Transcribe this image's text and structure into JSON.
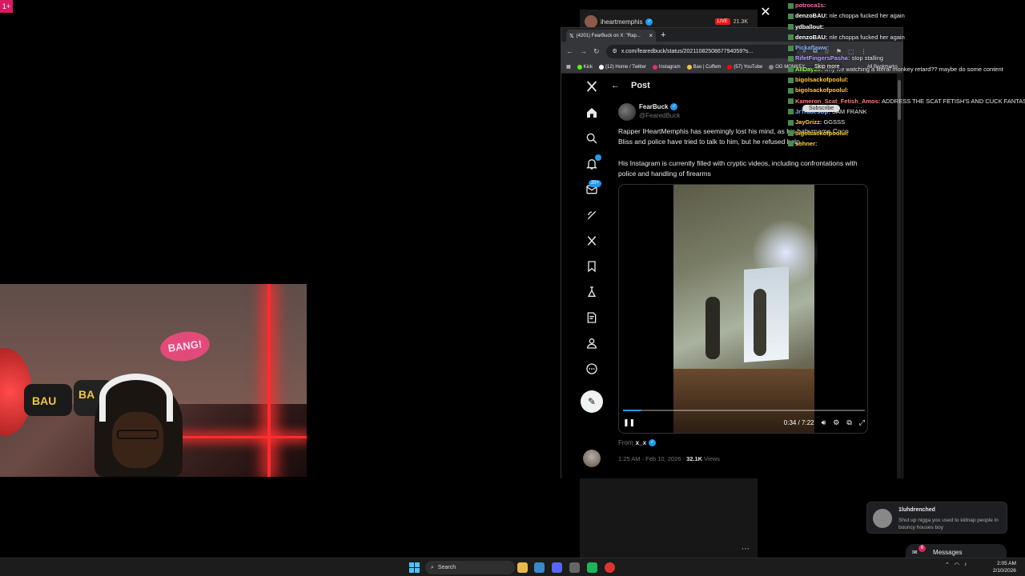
{
  "colors": {
    "accent": "#1d9bf0",
    "live": "#e91916",
    "corner_badge": "#d81b60",
    "taskbar": "#1c1c1c"
  },
  "corner_badge": {
    "icon": "plus-badge-icon",
    "label": "1+"
  },
  "behind_stream": {
    "channel": "iheartmemphis",
    "live": "LIVE",
    "viewers": "21.3K",
    "more": "⋯"
  },
  "browser": {
    "tab_title": "(4201) FearBuck on X: \"Rap...",
    "url": "x.com/fearedbuck/status/2021108250867794059?s...",
    "bookmarks": [
      {
        "label": "Kick",
        "color": "#53fc18"
      },
      {
        "label": "(12) Home / Twitter",
        "color": "#ffffff"
      },
      {
        "label": "Instagram",
        "color": "#e1306c"
      },
      {
        "label": "Bao | Cuffem",
        "color": "#f2c53d"
      },
      {
        "label": "(57) YouTube",
        "color": "#ff0000"
      },
      {
        "label": "OG MONKEY",
        "color": "#888888"
      }
    ],
    "all_bookmarks": "All Bookmarks"
  },
  "x": {
    "header_title": "Post",
    "nav_badges": {
      "notifications": "",
      "messages": "20+"
    },
    "post": {
      "author_name": "FearBuck",
      "author_handle": "@FearedBuck",
      "text1": "Rapper IHeartMemphis has seemingly lost his mind, as his babymama Coco Bliss and police have tried to talk to him, but he refused help.",
      "text2": "His Instagram is currently filled with cryptic videos, including confrontations with police and handling of firearms",
      "video": {
        "current": "0:34",
        "duration": "7:22",
        "separator": " / ",
        "progress": 0.077
      },
      "from_label": "From",
      "from_user": "x_x",
      "timestamp": "1:25 AM · Feb 10, 2026 · ",
      "views": "32.1K",
      "views_label": " Views"
    }
  },
  "chat": [
    {
      "user": "potroca1s:",
      "text": "",
      "color": "#ff6bb5"
    },
    {
      "user": "denzoBAU:",
      "text": "nle choppa fucked her again",
      "color": "#ffffff"
    },
    {
      "user": "ydballout:",
      "text": "",
      "color": "#ffffff"
    },
    {
      "user": "denzoBAU:",
      "text": "nle choppa fucked her again",
      "color": "#ffffff"
    },
    {
      "user": "Pickaflaww:",
      "text": "",
      "color": "#8ab4ff"
    },
    {
      "user": "RifetFingersPasha:",
      "text": "stop stalling",
      "color": "#b5a0ff"
    },
    {
      "user": "AllDay28:",
      "text": "why we watching a literal monkey retard?? maybe do some content",
      "color": "#9cff57"
    },
    {
      "user": "bigolsackofpoolul:",
      "text": "",
      "color": "#ffcc33"
    },
    {
      "user": "bigolsackofpoolul:",
      "text": "",
      "color": "#ffcc33"
    },
    {
      "user": "Kameron_Scat_Fetish_Amos:",
      "text": "ADDRESS THE SCAT FETISH'S AND CUCK FANTASIES @sierra @Cuffem",
      "color": "#ff7a7a"
    },
    {
      "user": "JrTradesUp:",
      "text": "SAM FRANK",
      "color": "#7ab8ff"
    },
    {
      "user": "JayGrizz:",
      "text": "GGSSS",
      "color": "#ffd23d"
    },
    {
      "user": "bigolsackofpoolul:",
      "text": "",
      "color": "#ffcc33"
    },
    {
      "user": "sohner:",
      "text": "",
      "color": "#ffd23d"
    }
  ],
  "overlay_buttons": {
    "skip_more": "Skip more",
    "subscribe": "Subscribe"
  },
  "notification": {
    "name": "1luhdrenched",
    "text": "Shut up nigga you used to kidnap people in bouncy houses boy"
  },
  "messages_bar": {
    "label": "Messages",
    "badge": "6"
  },
  "taskbar": {
    "search": "Search",
    "time": "2:05 AM",
    "date": "2/10/2026"
  }
}
